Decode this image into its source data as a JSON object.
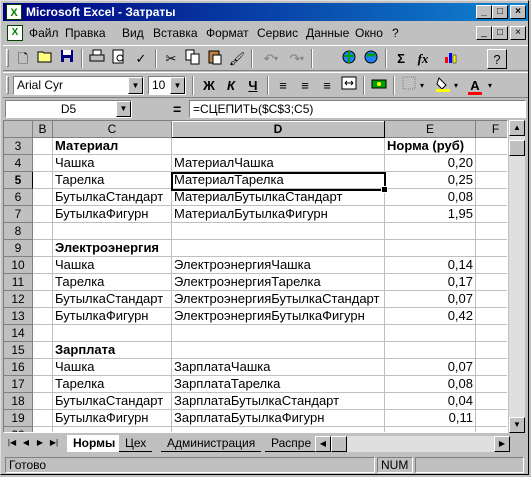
{
  "window": {
    "title": "Microsoft Excel - Затраты",
    "app_icon": "excel-icon",
    "controls": [
      "_",
      "□",
      "×"
    ]
  },
  "menu": {
    "items": [
      "Файл",
      "Правка",
      "Вид",
      "Вставка",
      "Формат",
      "Сервис",
      "Данные",
      "Окно",
      "?"
    ],
    "doc_controls": [
      "_",
      "□",
      "×"
    ]
  },
  "toolbar_standard": {
    "icons": [
      "new-document-icon",
      "open-folder-icon",
      "save-disk-icon",
      "print-icon",
      "print-preview-icon",
      "spelling-icon",
      "cut-icon",
      "copy-icon",
      "paste-icon",
      "format-painter-icon",
      "undo-icon",
      "redo-icon",
      "hyperlink-icon",
      "web-toolbar-icon",
      "autosum-icon",
      "function-icon",
      "help-assistant-icon"
    ],
    "glyphs": {
      "autosum": "Σ",
      "function": "fx"
    }
  },
  "toolbar_formatting": {
    "font_name": "Arial Cyr",
    "font_size": "10",
    "bold": "Ж",
    "italic": "К",
    "underline": "Ч",
    "font_color": "A",
    "fill_color_hex": "#ffff00",
    "font_color_hex": "#ff0000"
  },
  "formula_bar": {
    "name_box": "D5",
    "equals": "=",
    "formula": "=СЦЕПИТЬ($C$3;C5)"
  },
  "columns": [
    "B",
    "C",
    "D",
    "E",
    "F"
  ],
  "active_column": "D",
  "active_row": "5",
  "rows": [
    {
      "n": "3",
      "C": "Материал",
      "D": "",
      "E": "Норма (руб)",
      "bold": true
    },
    {
      "n": "4",
      "C": "Чашка",
      "D": "МатериалЧашка",
      "E": "0,20"
    },
    {
      "n": "5",
      "C": "Тарелка",
      "D": "МатериалТарелка",
      "E": "0,25"
    },
    {
      "n": "6",
      "C": "БутылкаСтандарт",
      "D": "МатериалБутылкаСтандарт",
      "E": "0,08"
    },
    {
      "n": "7",
      "C": "БутылкаФигурн",
      "D": "МатериалБутылкаФигурн",
      "E": "1,95"
    },
    {
      "n": "8",
      "C": "",
      "D": "",
      "E": ""
    },
    {
      "n": "9",
      "C": "Электроэнергия",
      "D": "",
      "E": "",
      "bold": true
    },
    {
      "n": "10",
      "C": "Чашка",
      "D": "ЭлектроэнергияЧашка",
      "E": "0,14"
    },
    {
      "n": "11",
      "C": "Тарелка",
      "D": "ЭлектроэнергияТарелка",
      "E": "0,17"
    },
    {
      "n": "12",
      "C": "БутылкаСтандарт",
      "D": "ЭлектроэнергияБутылкаСтандарт",
      "E": "0,07"
    },
    {
      "n": "13",
      "C": "БутылкаФигурн",
      "D": "ЭлектроэнергияБутылкаФигурн",
      "E": "0,42"
    },
    {
      "n": "14",
      "C": "",
      "D": "",
      "E": ""
    },
    {
      "n": "15",
      "C": "Зарплата",
      "D": "",
      "E": "",
      "bold": true
    },
    {
      "n": "16",
      "C": "Чашка",
      "D": "ЗарплатаЧашка",
      "E": "0,07"
    },
    {
      "n": "17",
      "C": "Тарелка",
      "D": "ЗарплатаТарелка",
      "E": "0,08"
    },
    {
      "n": "18",
      "C": "БутылкаСтандарт",
      "D": "ЗарплатаБутылкаСтандарт",
      "E": "0,04"
    },
    {
      "n": "19",
      "C": "БутылкаФигурн",
      "D": "ЗарплатаБутылкаФигурн",
      "E": "0,11"
    },
    {
      "n": "20",
      "C": "",
      "D": "",
      "E": ""
    }
  ],
  "sheet_tabs": [
    "Нормы",
    "Цех",
    "Администрация",
    "Распре"
  ],
  "active_tab": "Нормы",
  "status": {
    "ready": "Готово",
    "num": "NUM"
  }
}
